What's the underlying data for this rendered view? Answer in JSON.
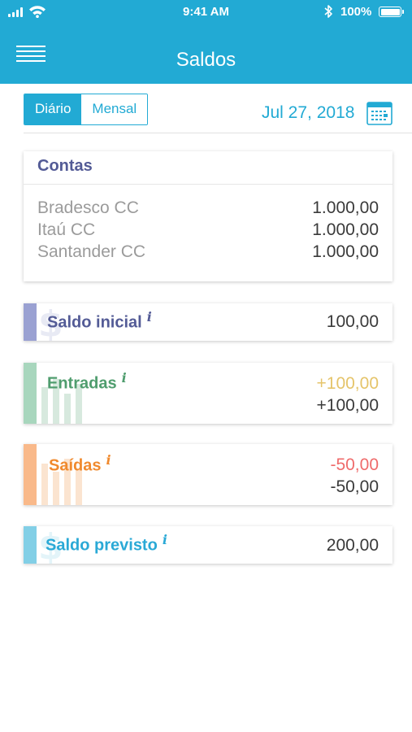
{
  "status_bar": {
    "time": "9:41 AM",
    "battery_percent": "100%"
  },
  "header": {
    "title": "Saldos",
    "menu_icon": "hamburger-menu-icon"
  },
  "period_toggle": {
    "options": [
      "Diário",
      "Mensal"
    ],
    "selected": "Diário"
  },
  "date": {
    "label": "Jul 27, 2018",
    "icon": "calendar-icon"
  },
  "contas": {
    "title": "Contas",
    "accounts": [
      {
        "name": "Bradesco CC",
        "amount": "1.000,00"
      },
      {
        "name": "Itaú CC",
        "amount": "1.000,00"
      },
      {
        "name": "Santander CC",
        "amount": "1.000,00"
      }
    ]
  },
  "saldo_inicial": {
    "label": "Saldo inicial",
    "info": "i",
    "value": "100,00",
    "color": "#9aa1d2"
  },
  "entradas": {
    "label": "Entradas",
    "info": "i",
    "forecast": "+100,00",
    "actual": "+100,00",
    "color": "#a8d6bd",
    "label_color": "#4f9d6e",
    "forecast_color": "#e5c46a"
  },
  "saidas": {
    "label": "Saídas",
    "info": "i",
    "forecast": "-50,00",
    "actual": "-50,00",
    "color": "#f9b98a",
    "label_color": "#f08a2e",
    "forecast_color": "#ef6b6b"
  },
  "saldo_previsto": {
    "label": "Saldo previsto",
    "info": "i",
    "value": "200,00",
    "color": "#82cfe6",
    "label_color": "#2aa9d6"
  },
  "colors": {
    "primary": "#22aad4",
    "title_text": "#535b96"
  }
}
